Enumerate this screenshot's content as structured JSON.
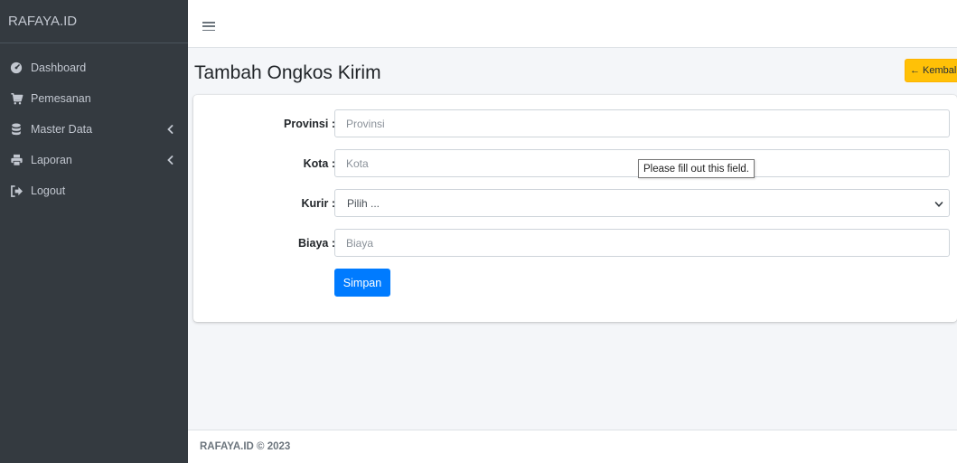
{
  "sidebar": {
    "brand": "RAFAYA.ID",
    "items": [
      {
        "label": "Dashboard",
        "icon": "tachometer-icon"
      },
      {
        "label": "Pemesanan",
        "icon": "shopping-cart-icon"
      },
      {
        "label": "Master Data",
        "icon": "database-icon",
        "has_submenu": true
      },
      {
        "label": "Laporan",
        "icon": "print-icon",
        "has_submenu": true
      },
      {
        "label": "Logout",
        "icon": "sign-out-icon"
      }
    ]
  },
  "header": {
    "title": "Tambah Ongkos Kirim",
    "back_label": "← Kembali"
  },
  "form": {
    "provinsi": {
      "label": "Provinsi :",
      "placeholder": "Provinsi",
      "value": ""
    },
    "kota": {
      "label": "Kota :",
      "placeholder": "Kota",
      "value": ""
    },
    "kurir": {
      "label": "Kurir :",
      "selected": "Pilih ..."
    },
    "biaya": {
      "label": "Biaya :",
      "placeholder": "Biaya",
      "value": ""
    },
    "submit_label": "Simpan"
  },
  "validation_tooltip": "Please fill out this field.",
  "footer": {
    "text": "RAFAYA.ID © 2023"
  },
  "colors": {
    "sidebar_bg": "#343a40",
    "primary": "#007bff",
    "warning": "#ffc107",
    "content_bg": "#f4f6f9"
  }
}
